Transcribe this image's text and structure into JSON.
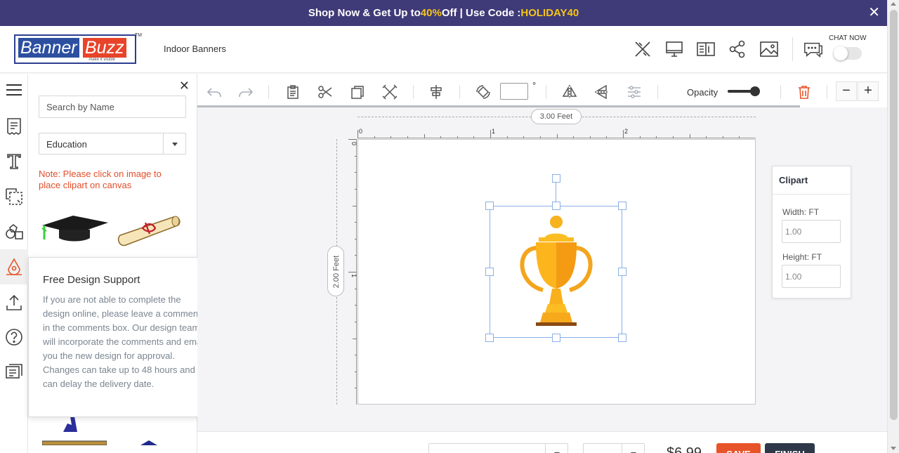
{
  "promo": {
    "prefix": "Shop Now & Get Up to ",
    "percent": "40%",
    "middle": " Off | Use Code : ",
    "code": "HOLIDAY40",
    "close": "✕"
  },
  "header": {
    "logo_word1": "Banner",
    "logo_word2": "Buzz",
    "logo_tagline": "make it visible",
    "logo_tm": "TM",
    "product_name": "Indoor Banners",
    "chat_label": "CHAT NOW",
    "chat_enabled": false
  },
  "panel": {
    "close": "✕",
    "search_placeholder": "Search by Name",
    "category_selected": "Education",
    "note": "Note: Please click on image to place clipart on canvas"
  },
  "support_popup": {
    "title": "Free Design Support",
    "body": "If you are not able to complete the design online, please leave a comments in the comments box. Our design team will incorporate the comments and email you the new design for approval. Changes can take up to 48 hours and can delay the delivery date.",
    "close": "✕"
  },
  "toolbar": {
    "angle_value": "",
    "degree_symbol": "°",
    "opacity_label": "Opacity",
    "opacity_value": 0.9,
    "zoom_out": "−",
    "zoom_in": "+"
  },
  "canvas": {
    "width_label": "3.00 Feet",
    "height_label": "2.00 Feet",
    "top_ruler_ticks": [
      "0",
      "1",
      "2"
    ],
    "left_ruler_ticks": [
      "0",
      "1"
    ]
  },
  "clipart_props": {
    "title": "Clipart",
    "width_label": "Width:",
    "height_label": "Height:",
    "unit": "FT",
    "width_value": "1.00",
    "height_value": "1.00"
  },
  "bottom_bar": {
    "price": "$6.99",
    "save_label": "SAVE",
    "finish_label": "FINISH"
  },
  "colors": {
    "promo_bg": "#3f3a78",
    "promo_highlight": "#f5c518",
    "note_text": "#e04e2b",
    "delete_icon": "#e8542a",
    "save_button": "#e8542a",
    "finish_button": "#2f3848",
    "selection_border": "#8ab0e6"
  }
}
